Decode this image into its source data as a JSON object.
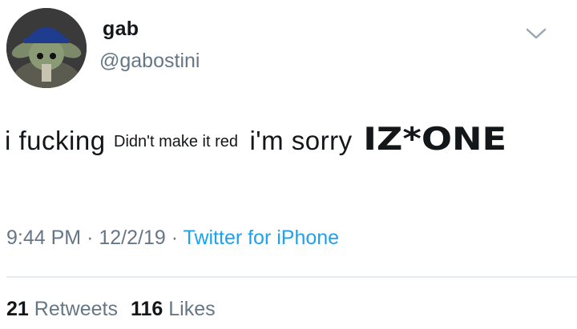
{
  "user": {
    "display_name": "gab",
    "handle": "@gabostini"
  },
  "tweet": {
    "text_parts": [
      "i fucking",
      "Didn't make it red",
      "i'm sorry",
      "IZ*ONE"
    ],
    "time": "9:44 PM",
    "date": "12/2/19",
    "source": "Twitter for iPhone",
    "separator": "·"
  },
  "stats": {
    "retweets_count": "21",
    "retweets_label": "Retweets",
    "likes_count": "116",
    "likes_label": "Likes"
  },
  "icons": {
    "avatar": "avatar-image",
    "menu": "chevron-down-icon"
  },
  "colors": {
    "text": "#14171a",
    "muted": "#657786",
    "link": "#1da1f2",
    "divider": "#e6ecf0"
  }
}
